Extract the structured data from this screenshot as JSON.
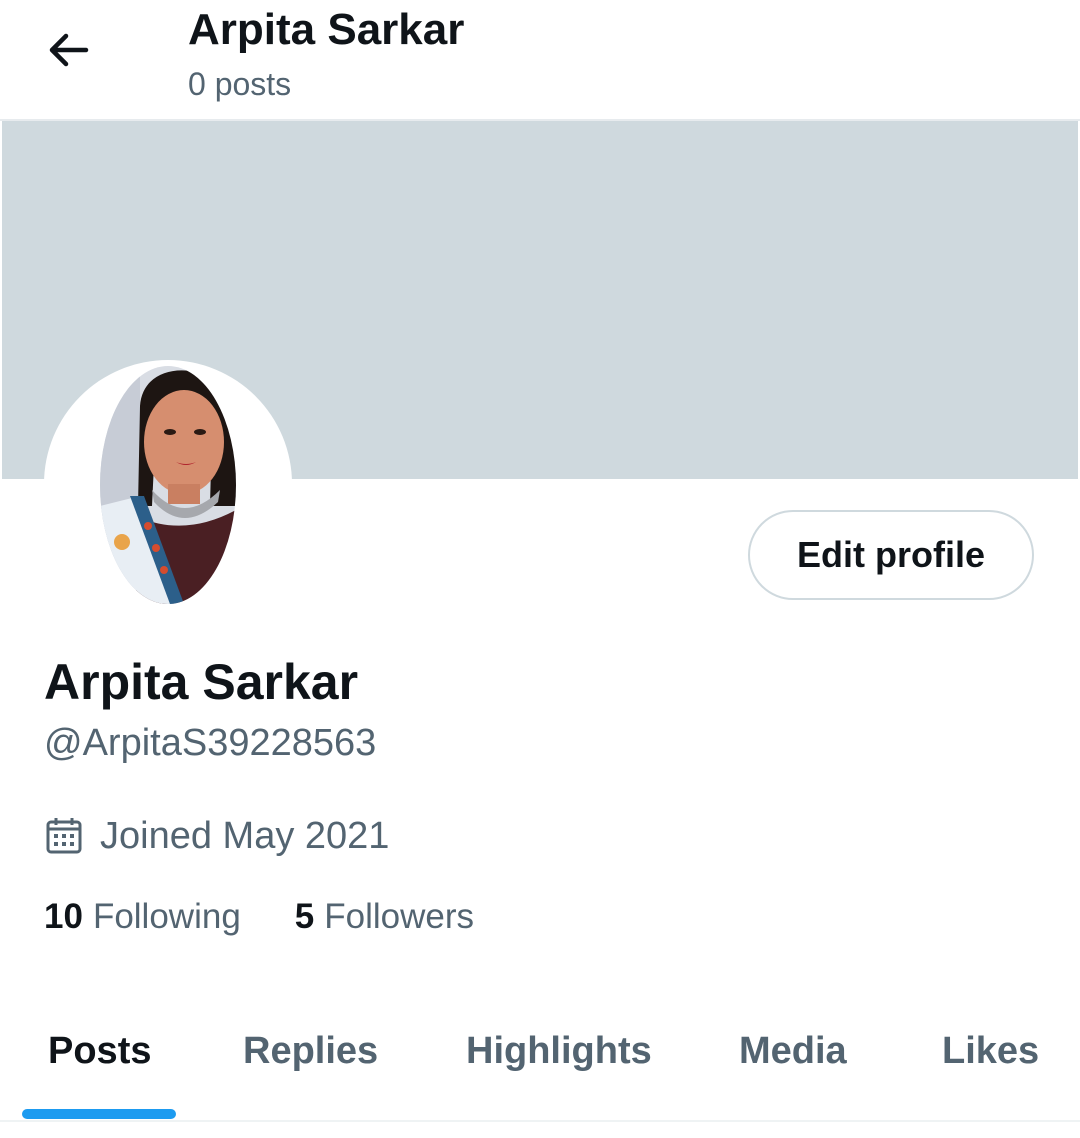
{
  "header": {
    "title": "Arpita Sarkar",
    "post_count": "0 posts",
    "back_icon": "arrow-left-icon"
  },
  "colors": {
    "banner": "#cfd9de",
    "accent": "#1d9bf0",
    "primary_text": "#0f1419",
    "secondary_text": "#536471",
    "border": "#cfd9de"
  },
  "profile": {
    "display_name": "Arpita Sarkar",
    "handle": "@ArpitaS39228563",
    "joined": "Joined May 2021",
    "joined_icon": "calendar-icon",
    "edit_button_label": "Edit profile"
  },
  "stats": {
    "following_count": "10",
    "following_label": "Following",
    "followers_count": "5",
    "followers_label": "Followers"
  },
  "tabs": [
    {
      "label": "Posts",
      "active": true
    },
    {
      "label": "Replies",
      "active": false
    },
    {
      "label": "Highlights",
      "active": false
    },
    {
      "label": "Media",
      "active": false
    },
    {
      "label": "Likes",
      "active": false
    }
  ]
}
